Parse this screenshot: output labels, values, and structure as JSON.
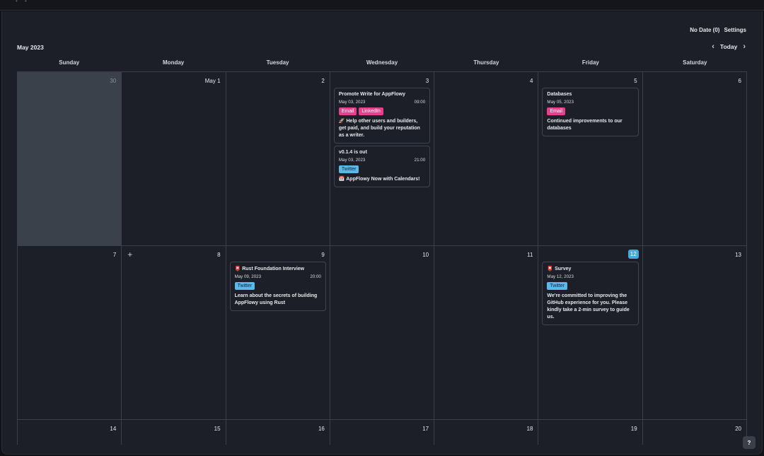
{
  "header": {
    "no_date": "No Date (0)",
    "settings": "Settings",
    "month_title": "May 2023",
    "today": "Today",
    "prev_icon": "chevron-left-icon",
    "next_icon": "chevron-right-icon"
  },
  "weekdays": [
    "Sunday",
    "Monday",
    "Tuesday",
    "Wednesday",
    "Thursday",
    "Friday",
    "Saturday"
  ],
  "colors": {
    "email_tag": "#e7418e",
    "linkedin_tag": "#e7418e",
    "twitter_tag": "#5ab9ea",
    "today_badge": "#4aa8d8"
  },
  "weeks": [
    [
      {
        "label": "30",
        "outside": true
      },
      {
        "label": "May 1"
      },
      {
        "label": "2"
      },
      {
        "label": "3",
        "events": [
          {
            "title": "Promote Write for AppFlowy",
            "date": "May 03, 2023",
            "time": "09:00",
            "tags": [
              {
                "label": "Email",
                "kind": "email"
              },
              {
                "label": "LinkedIn",
                "kind": "linkedin"
              }
            ],
            "body": "🚀 Help other users and builders, get paid, and build your reputation as a writer."
          },
          {
            "title": "v0.1.4 is out",
            "date": "May 03, 2023",
            "time": "21:00",
            "tags": [
              {
                "label": "Twitter",
                "kind": "twitter"
              }
            ],
            "body": "📅 AppFlowy Now with Calendars!"
          }
        ]
      },
      {
        "label": "4"
      },
      {
        "label": "5",
        "events": [
          {
            "title": "Databases",
            "date": "May 05, 2023",
            "time": "",
            "tags": [
              {
                "label": "Email",
                "kind": "email"
              }
            ],
            "body": "Continued improvements to our databases"
          }
        ]
      },
      {
        "label": "6"
      }
    ],
    [
      {
        "label": "7"
      },
      {
        "label": "8",
        "plus": true
      },
      {
        "label": "9",
        "events": [
          {
            "title": "📮 Rust Foundation Interview",
            "date": "May 09, 2023",
            "time": "20:00",
            "tags": [
              {
                "label": "Twitter",
                "kind": "twitter"
              }
            ],
            "body": "Learn about the secrets of building AppFlowy using Rust"
          }
        ]
      },
      {
        "label": "10"
      },
      {
        "label": "11"
      },
      {
        "label": "12",
        "today": true,
        "events": [
          {
            "title": "📮 Survey",
            "date": "May 12, 2023",
            "time": "",
            "tags": [
              {
                "label": "Twitter",
                "kind": "twitter"
              }
            ],
            "body": "We're committed to improving the GitHub experience for you. Please kindly take a 2-min survey to guide us."
          }
        ]
      },
      {
        "label": "13"
      }
    ],
    [
      {
        "label": "14"
      },
      {
        "label": "15"
      },
      {
        "label": "16"
      },
      {
        "label": "17"
      },
      {
        "label": "18"
      },
      {
        "label": "19"
      },
      {
        "label": "20"
      }
    ]
  ],
  "help": "?"
}
